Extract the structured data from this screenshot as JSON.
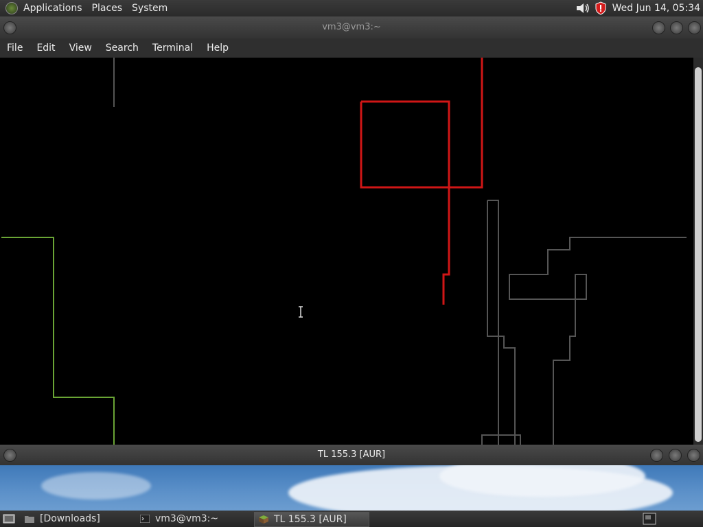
{
  "top_panel": {
    "menus": [
      "Applications",
      "Places",
      "System"
    ],
    "clock": "Wed Jun 14, 05:34",
    "icons": [
      "distro-logo-icon",
      "volume-icon",
      "security-shield-icon"
    ]
  },
  "terminal_window": {
    "title": "vm3@vm3:~",
    "menu": [
      "File",
      "Edit",
      "View",
      "Search",
      "Terminal",
      "Help"
    ]
  },
  "second_window": {
    "title": "TL 155.3 [AUR]"
  },
  "taskbar": {
    "items": [
      {
        "label": "[Downloads]",
        "icon": "folder-icon"
      },
      {
        "label": "vm3@vm3:~",
        "icon": "terminal-icon"
      },
      {
        "label": "TL 155.3 [AUR]",
        "icon": "app-cube-icon",
        "active": true
      }
    ]
  },
  "colors": {
    "trace_red": "#d01616",
    "trace_green": "#6aa535",
    "trace_gray": "#555555"
  }
}
